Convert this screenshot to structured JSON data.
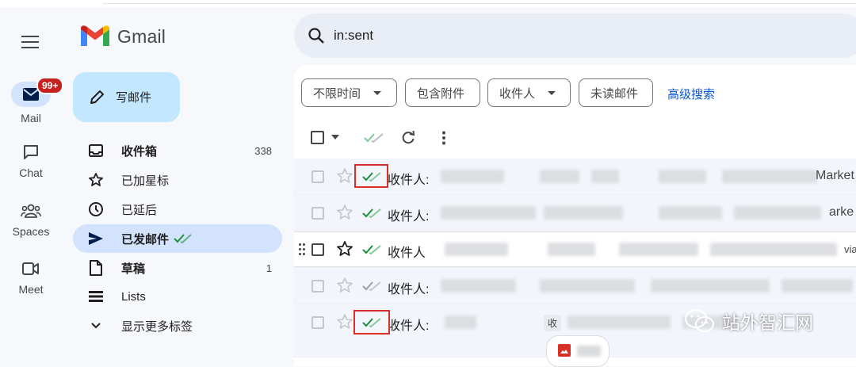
{
  "app": {
    "name": "Gmail"
  },
  "rail": {
    "items": [
      {
        "label": "Mail",
        "badge": "99+"
      },
      {
        "label": "Chat"
      },
      {
        "label": "Spaces"
      },
      {
        "label": "Meet"
      }
    ]
  },
  "compose": {
    "label": "写邮件"
  },
  "nav": {
    "items": [
      {
        "label": "收件箱",
        "count": "338"
      },
      {
        "label": "已加星标"
      },
      {
        "label": "已延后"
      },
      {
        "label": "已发邮件"
      },
      {
        "label": "草稿",
        "count": "1"
      },
      {
        "label": "Lists"
      },
      {
        "label": "显示更多标签"
      }
    ]
  },
  "search": {
    "value": "in:sent"
  },
  "filters": {
    "chips": [
      "不限时间",
      "包含附件",
      "收件人",
      "未读邮件"
    ],
    "advanced_link": "高级搜索"
  },
  "rows": [
    {
      "recipient": "收件人:",
      "snippet_tail": "Market"
    },
    {
      "recipient": "收件人:",
      "snippet_tail": "arke"
    },
    {
      "recipient": "收件人",
      "snippet_tail": "via"
    },
    {
      "recipient": "收件人:"
    },
    {
      "recipient": "收件人:",
      "tag": "收"
    }
  ],
  "watermark": {
    "text": "站外智汇网"
  },
  "colors": {
    "accent": "#0b57d0",
    "selected_nav": "#d3e3fd",
    "compose": "#c2e7ff",
    "badge": "#c5221f",
    "highlight": "#d93025",
    "tick": "#1e8e3e"
  }
}
